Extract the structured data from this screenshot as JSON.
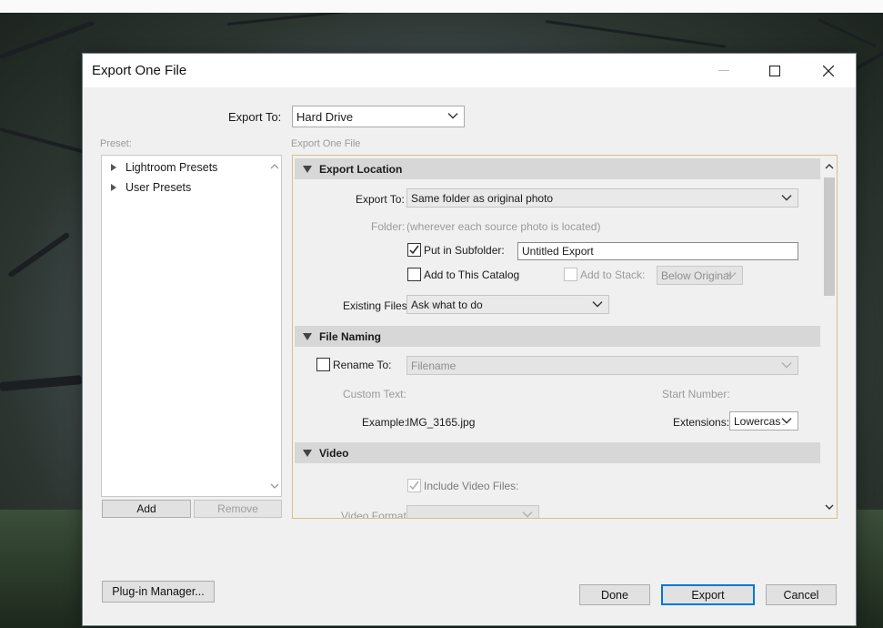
{
  "dialog": {
    "title": "Export One File"
  },
  "export_to": {
    "label": "Export To:",
    "value": "Hard Drive"
  },
  "preset": {
    "label": "Preset:",
    "items": [
      {
        "label": "Lightroom Presets"
      },
      {
        "label": "User Presets"
      }
    ],
    "add_label": "Add",
    "remove_label": "Remove"
  },
  "settings": {
    "panel_label": "Export One File",
    "export_location": {
      "title": "Export Location",
      "export_to_label": "Export To:",
      "export_to_value": "Same folder as original photo",
      "folder_label": "Folder:",
      "folder_value": "(wherever each source photo is located)",
      "put_in_subfolder_label": "Put in Subfolder:",
      "put_in_subfolder_checked": true,
      "subfolder_value": "Untitled Export",
      "add_to_catalog_label": "Add to This Catalog",
      "add_to_catalog_checked": false,
      "add_to_stack_label": "Add to Stack:",
      "stack_value": "Below Original",
      "existing_files_label": "Existing Files:",
      "existing_files_value": "Ask what to do"
    },
    "file_naming": {
      "title": "File Naming",
      "rename_to_label": "Rename To:",
      "rename_to_checked": false,
      "rename_value": "Filename",
      "custom_text_label": "Custom Text:",
      "start_number_label": "Start Number:",
      "example_label": "Example:",
      "example_value": "IMG_3165.jpg",
      "extensions_label": "Extensions:",
      "extensions_value": "Lowercase"
    },
    "video": {
      "title": "Video",
      "include_video_label": "Include Video Files:",
      "include_video_checked": true,
      "video_format_label": "Video Format:"
    }
  },
  "footer": {
    "plugin_manager_label": "Plug-in Manager...",
    "done_label": "Done",
    "export_label": "Export",
    "cancel_label": "Cancel"
  }
}
